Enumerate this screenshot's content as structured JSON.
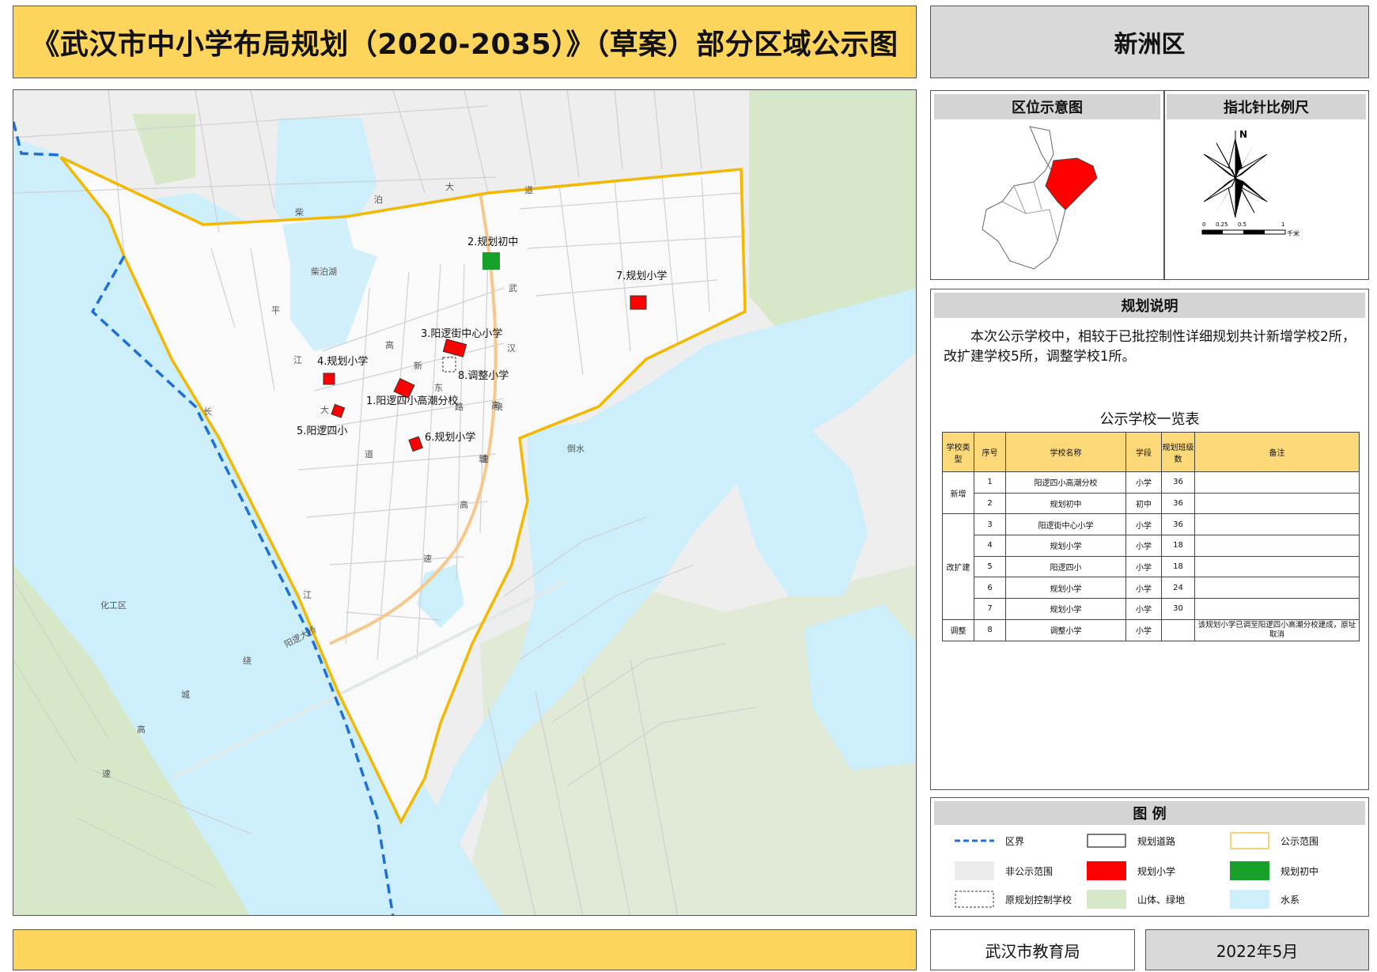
{
  "header": {
    "title": "《武汉市中小学布局规划（2020-2035）》（草案）部分区域公示图",
    "district": "新洲区"
  },
  "location_panel": {
    "location_title": "区位示意图",
    "compass_title": "指北针比例尺",
    "north_label": "N",
    "scale_ticks": [
      "0",
      "0.25",
      "0.5",
      "1"
    ],
    "scale_unit": "千米"
  },
  "planning_notes": {
    "title": "规划说明",
    "text": "本次公示学校中，相较于已批控制性详细规划共计新增学校2所，改扩建学校5所，调整学校1所。",
    "table_title": "公示学校一览表",
    "columns": [
      "学校类型",
      "序号",
      "学校名称",
      "学段",
      "规划班级数",
      "备注"
    ],
    "rows": [
      {
        "type": "新增",
        "no": "1",
        "name": "阳逻四小高潮分校",
        "stage": "小学",
        "classes": "36",
        "note": ""
      },
      {
        "type": "",
        "no": "2",
        "name": "规划初中",
        "stage": "初中",
        "classes": "36",
        "note": ""
      },
      {
        "type": "改扩建",
        "no": "3",
        "name": "阳逻街中心小学",
        "stage": "小学",
        "classes": "36",
        "note": ""
      },
      {
        "type": "",
        "no": "4",
        "name": "规划小学",
        "stage": "小学",
        "classes": "18",
        "note": ""
      },
      {
        "type": "",
        "no": "5",
        "name": "阳逻四小",
        "stage": "小学",
        "classes": "18",
        "note": ""
      },
      {
        "type": "",
        "no": "6",
        "name": "规划小学",
        "stage": "小学",
        "classes": "24",
        "note": ""
      },
      {
        "type": "",
        "no": "7",
        "name": "规划小学",
        "stage": "小学",
        "classes": "30",
        "note": ""
      },
      {
        "type": "调整",
        "no": "8",
        "name": "调整小学",
        "stage": "小学",
        "classes": "",
        "note": "该规划小学已调至阳逻四小高潮分校建成，原址取消"
      }
    ]
  },
  "legend": {
    "title": "图  例",
    "items": [
      {
        "label": "区界",
        "icon": "dashed-blue-line"
      },
      {
        "label": "规划道路",
        "icon": "road-outline"
      },
      {
        "label": "公示范围",
        "icon": "yellow-outline"
      },
      {
        "label": "非公示范围",
        "icon": "grey-fill"
      },
      {
        "label": "规划小学",
        "icon": "red-fill"
      },
      {
        "label": "规划初中",
        "icon": "green-fill"
      },
      {
        "label": "原规划控制学校",
        "icon": "dashed-box"
      },
      {
        "label": "山体、绿地",
        "icon": "green-light-fill"
      },
      {
        "label": "水系",
        "icon": "light-blue-fill"
      }
    ],
    "colors": {
      "water": "#cdeefb",
      "green": "#d7e8c8",
      "non_public": "#ececec",
      "primary_school": "#ff0000",
      "middle_school": "#17a12a",
      "boundary": "#f5b800",
      "district_line": "#1e6fd6"
    }
  },
  "map": {
    "schools": [
      {
        "label": "1.阳逻四小高潮分校"
      },
      {
        "label": "2.规划初中"
      },
      {
        "label": "3.阳逻街中心小学"
      },
      {
        "label": "4.规划小学"
      },
      {
        "label": "5.阳逻四小"
      },
      {
        "label": "6.规划小学"
      },
      {
        "label": "7.规划小学"
      },
      {
        "label": "8.调整小学"
      }
    ],
    "place_labels": [
      "柴泊湖",
      "倒水",
      "化工区",
      "阳逻大桥"
    ],
    "road_chars": {
      "chai": "柴",
      "bo": "泊",
      "da1": "大",
      "dao1": "道",
      "ping": "平",
      "jiang1": "江",
      "da2": "大",
      "dao2": "道",
      "wu": "武",
      "han": "汉",
      "gao1": "高",
      "su1": "速",
      "gao2": "高",
      "xin": "新",
      "dong": "东",
      "lu": "路",
      "rao1": "绕",
      "cheng1": "城",
      "gao3": "高",
      "su2": "速",
      "chang": "长",
      "jiang2": "江",
      "rao2": "绕",
      "cheng2": "城",
      "gao4": "高",
      "su3": "速"
    }
  },
  "footer": {
    "org": "武汉市教育局",
    "date": "2022年5月"
  }
}
